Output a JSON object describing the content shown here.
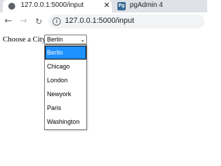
{
  "browser": {
    "tabs": [
      {
        "title": "127.0.0.1:5000/input",
        "active": true,
        "close": "✕"
      },
      {
        "title": "pgAdmin 4",
        "active": false,
        "favicon_text": "Pg"
      }
    ],
    "url": "127.0.0.1:5000/input",
    "colors": {
      "tabstrip": "#dee1e6",
      "omnibox": "#f1f3f4",
      "highlight": "#1e90ff"
    }
  },
  "page": {
    "label": "Choose a City",
    "select": {
      "value": "Berlin",
      "arrow": "⌄",
      "options": [
        "Berlin",
        "Chicago",
        "London",
        "Newyork",
        "Paris",
        "Washington"
      ],
      "highlighted": "Berlin"
    }
  },
  "icons": {
    "back": "arrow-left-icon",
    "forward": "arrow-right-icon",
    "reload": "reload-icon",
    "info": "info-icon",
    "tab_favicon": "globe-icon",
    "pgadmin": "pgadmin-icon"
  }
}
